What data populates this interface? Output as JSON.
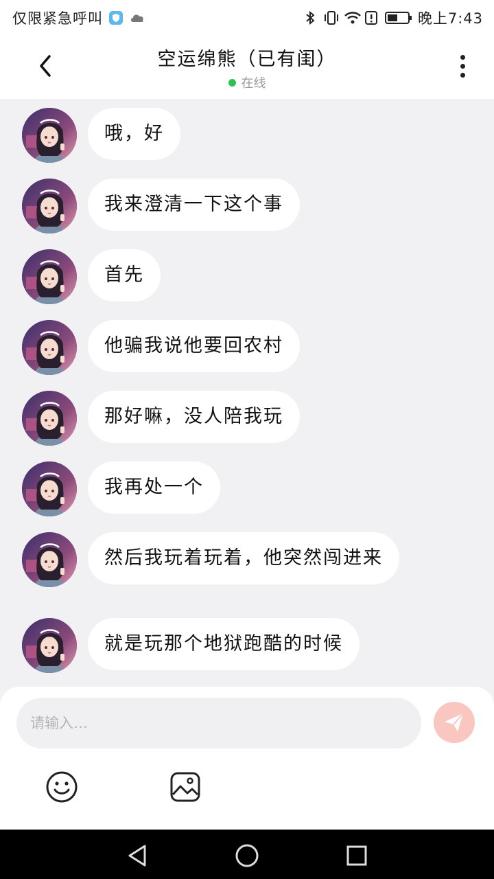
{
  "status_bar": {
    "left_text": "仅限紧急呼叫",
    "time": "晚上7:43",
    "icons": [
      "shield-app-icon",
      "cloud-icon",
      "bluetooth-icon",
      "vibrate-icon",
      "wifi-icon",
      "alert-icon",
      "battery-icon"
    ]
  },
  "header": {
    "title": "空运绵熊（已有闺）",
    "status": "在线",
    "status_color": "#2bc24f"
  },
  "messages": [
    {
      "text": "哦，好"
    },
    {
      "text": "我来澄清一下这个事"
    },
    {
      "text": "首先"
    },
    {
      "text": "他骗我说他要回农村"
    },
    {
      "text": "那好嘛，没人陪我玩"
    },
    {
      "text": "我再处一个"
    },
    {
      "text": "然后我玩着玩着，他突然闯进来"
    },
    {
      "text": "就是玩那个地狱跑酷的时候"
    }
  ],
  "composer": {
    "placeholder": "请输入…",
    "send_color": "#f9c6c0"
  },
  "nav_bar": {
    "items": [
      "back-triangle-icon",
      "home-circle-icon",
      "recents-square-icon"
    ]
  }
}
